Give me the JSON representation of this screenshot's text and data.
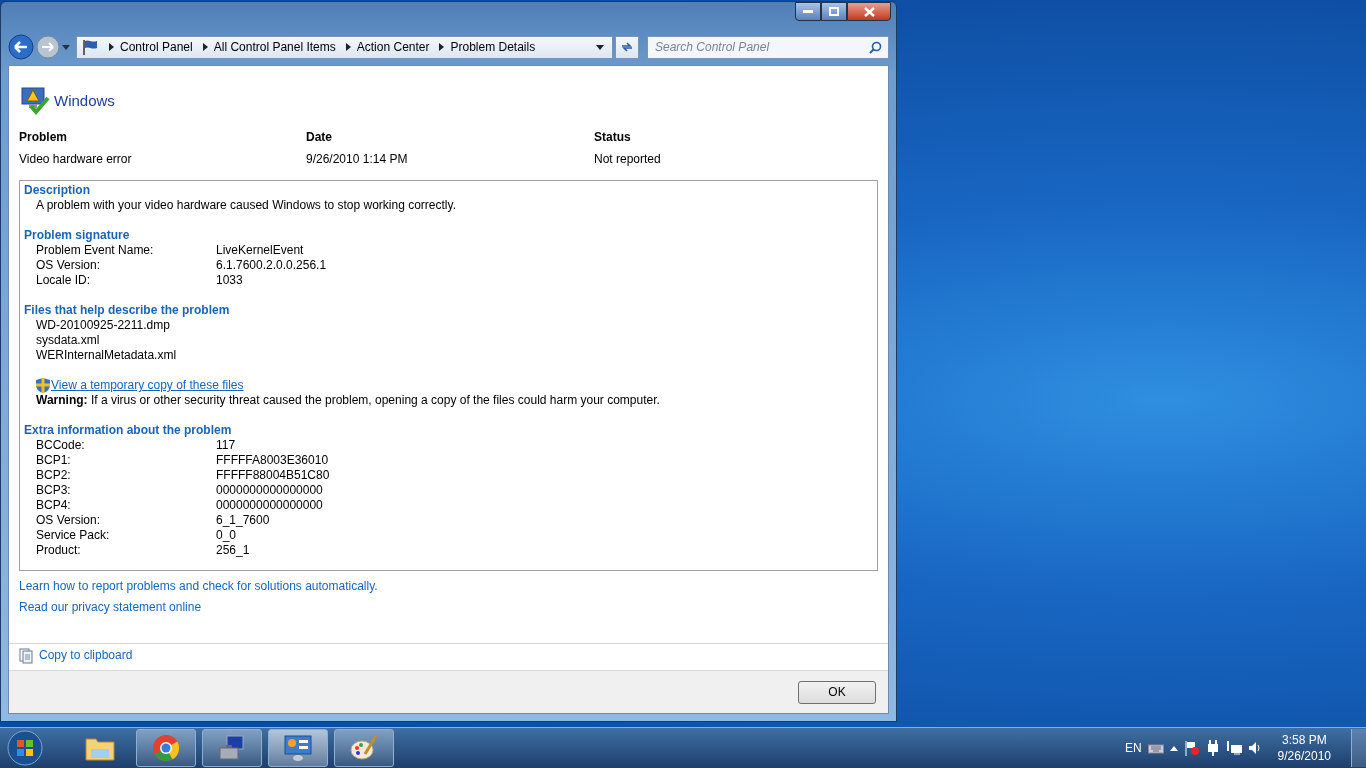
{
  "address_bar": {
    "breadcrumbs": [
      "Control Panel",
      "All Control Panel Items",
      "Action Center",
      "Problem Details"
    ]
  },
  "search": {
    "placeholder": "Search Control Panel"
  },
  "header": {
    "title": "Windows"
  },
  "summary": [
    {
      "heading": "Problem",
      "value": "Video hardware error"
    },
    {
      "heading": "Date",
      "value": "9/26/2010 1:14 PM"
    },
    {
      "heading": "Status",
      "value": "Not reported"
    }
  ],
  "sections": [
    {
      "kind": "paragraph",
      "title": "Description",
      "text": "A problem with your video hardware caused Windows to stop working correctly."
    },
    {
      "kind": "pairs",
      "title": "Problem signature",
      "rows": [
        [
          "Problem Event Name:",
          "LiveKernelEvent"
        ],
        [
          "OS Version:",
          "6.1.7600.2.0.0.256.1"
        ],
        [
          "Locale ID:",
          "1033"
        ]
      ]
    },
    {
      "kind": "files",
      "title": "Files that help describe the problem",
      "files": [
        "WD-20100925-2211.dmp",
        "sysdata.xml",
        "WERInternalMetadata.xml"
      ],
      "link": "View a temporary copy of these files",
      "warning": "**Warning:** If a virus or other security threat caused the problem, opening a copy of the files could harm your computer."
    },
    {
      "kind": "pairs",
      "title": "Extra information about the problem",
      "rows": [
        [
          "BCCode:",
          "117"
        ],
        [
          "BCP1:",
          "FFFFFA8003E36010"
        ],
        [
          "BCP2:",
          "FFFFF88004B51C80"
        ],
        [
          "BCP3:",
          "0000000000000000"
        ],
        [
          "BCP4:",
          "0000000000000000"
        ],
        [
          "OS Version:",
          "6_1_7600"
        ],
        [
          "Service Pack:",
          "0_0"
        ],
        [
          "Product:",
          "256_1"
        ]
      ]
    }
  ],
  "links": [
    "Learn how to report problems and check for solutions automatically.",
    "Read our privacy statement online"
  ],
  "copy_link": "Copy to clipboard",
  "ok_button": "OK",
  "taskbar": {
    "apps": [
      {
        "kind": "folder",
        "running": false,
        "selected": false
      },
      {
        "kind": "browser",
        "running": true,
        "selected": false
      },
      {
        "kind": "computer",
        "running": true,
        "selected": false
      },
      {
        "kind": "control-panel",
        "running": true,
        "selected": true
      },
      {
        "kind": "paint",
        "running": true,
        "selected": false
      }
    ],
    "language": "EN",
    "time": "3:58 PM",
    "date": "9/26/2010"
  }
}
